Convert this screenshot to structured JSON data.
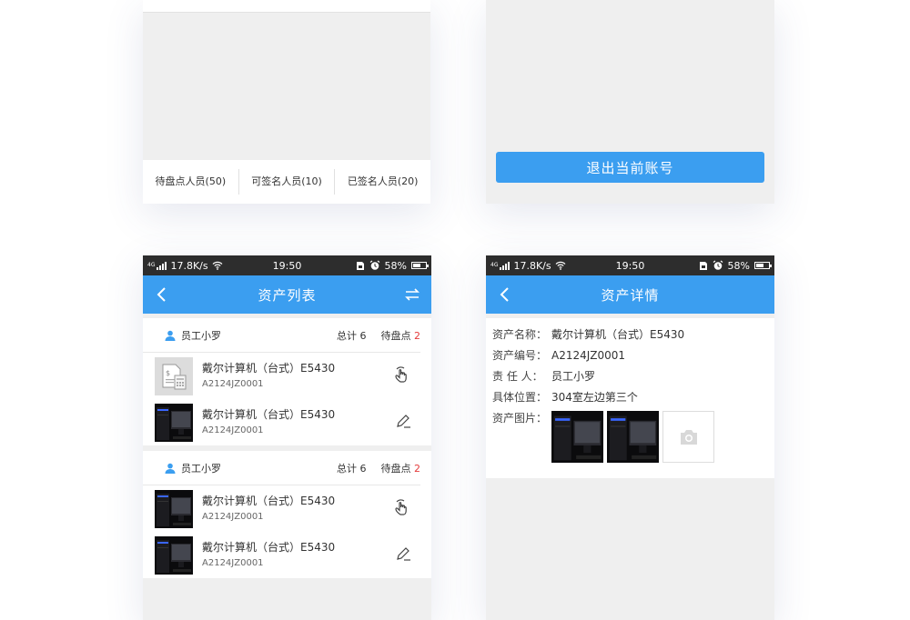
{
  "top_left": {
    "tabs": [
      {
        "label": "待盘点人员(50)"
      },
      {
        "label": "可签名人员(10)"
      },
      {
        "label": "已签名人员(20)"
      }
    ]
  },
  "top_right": {
    "logout_label": "退出当前账号"
  },
  "status_bar": {
    "network": "4G",
    "speed": "17.8K/s",
    "time": "19:50",
    "battery": "58%",
    "battery_level": 0.58
  },
  "asset_list": {
    "title": "资产列表",
    "groups": [
      {
        "user": "员工小罗",
        "total_label": "总计",
        "total": "6",
        "pending_label": "待盘点",
        "pending": "2",
        "items": [
          {
            "name": "戴尔计算机（台式）E5430",
            "code": "A2124JZ0001",
            "thumb": "document-thumbnail",
            "action": "hand-touch-icon"
          },
          {
            "name": "戴尔计算机（台式）E5430",
            "code": "A2124JZ0001",
            "thumb": "computer-photo",
            "action": "edit-pen-icon"
          }
        ]
      },
      {
        "user": "员工小罗",
        "total_label": "总计",
        "total": "6",
        "pending_label": "待盘点",
        "pending": "2",
        "items": [
          {
            "name": "戴尔计算机（台式）E5430",
            "code": "A2124JZ0001",
            "thumb": "computer-photo",
            "action": "hand-touch-icon"
          },
          {
            "name": "戴尔计算机（台式）E5430",
            "code": "A2124JZ0001",
            "thumb": "computer-photo",
            "action": "edit-pen-icon"
          }
        ]
      }
    ]
  },
  "asset_detail": {
    "title": "资产详情",
    "fields": [
      {
        "label": "资产名称：",
        "value": "戴尔计算机（台式）E5430"
      },
      {
        "label": "资产编号：",
        "value": "A2124JZ0001"
      },
      {
        "label": "责 任 人：",
        "value": "员工小罗"
      },
      {
        "label": "具体位置：",
        "value": "304室左边第三个"
      }
    ],
    "photos_label": "资产图片："
  },
  "colors": {
    "primary": "#3b9ef0",
    "status_bar": "#2d2d2d",
    "pending_red": "#e43b3b",
    "background": "#efefef"
  }
}
